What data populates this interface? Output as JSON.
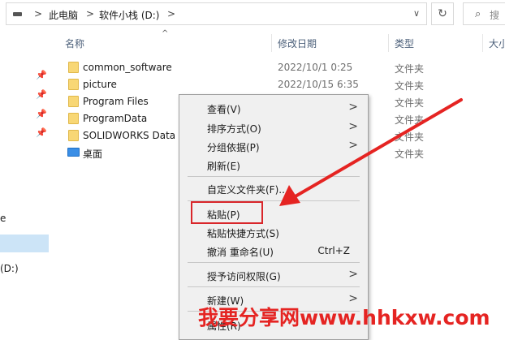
{
  "addressbar": {
    "sep1": ">",
    "crumb1": "此电脑",
    "sep2": ">",
    "crumb2": "软件小栈 (D:)",
    "sep3": ">",
    "dropdown": "∨",
    "refresh": "↻",
    "search_placeholder": "搜"
  },
  "nav": {
    "frag_e": "e",
    "frag_drive": "(D:)"
  },
  "columns": {
    "name": "名称",
    "date": "修改日期",
    "type": "类型",
    "size": "大小",
    "sort_indicator": "^"
  },
  "files": [
    {
      "name": "common_software",
      "date": "2022/10/1 0:25",
      "type": "文件夹"
    },
    {
      "name": "picture",
      "date": "2022/10/15 6:35",
      "type": "文件夹"
    },
    {
      "name": "Program Files",
      "date": "",
      "type": "文件夹"
    },
    {
      "name": "ProgramData",
      "date": "",
      "type": "文件夹"
    },
    {
      "name": "SOLIDWORKS Data",
      "date": "",
      "type": "文件夹"
    },
    {
      "name": "桌面",
      "date": "",
      "type": "文件夹"
    }
  ],
  "context_menu": {
    "view": "查看(V)",
    "sort": "排序方式(O)",
    "group": "分组依据(P)",
    "refresh": "刷新(E)",
    "customize": "自定义文件夹(F)...",
    "paste": "粘贴(P)",
    "paste_shortcut": "粘贴快捷方式(S)",
    "undo_rename": "撤消 重命名(U)",
    "undo_shortcut": "Ctrl+Z",
    "grant_access": "授予访问权限(G)",
    "new": "新建(W)",
    "properties": "属性(R)",
    "submenu_glyph": ">"
  },
  "watermark": "我要分享网www.hhkxw.com",
  "colors": {
    "highlight_box": "#d9262a",
    "arrow": "#e52422",
    "selection": "#cce4f7",
    "menu_bg": "#f0f0f0"
  }
}
